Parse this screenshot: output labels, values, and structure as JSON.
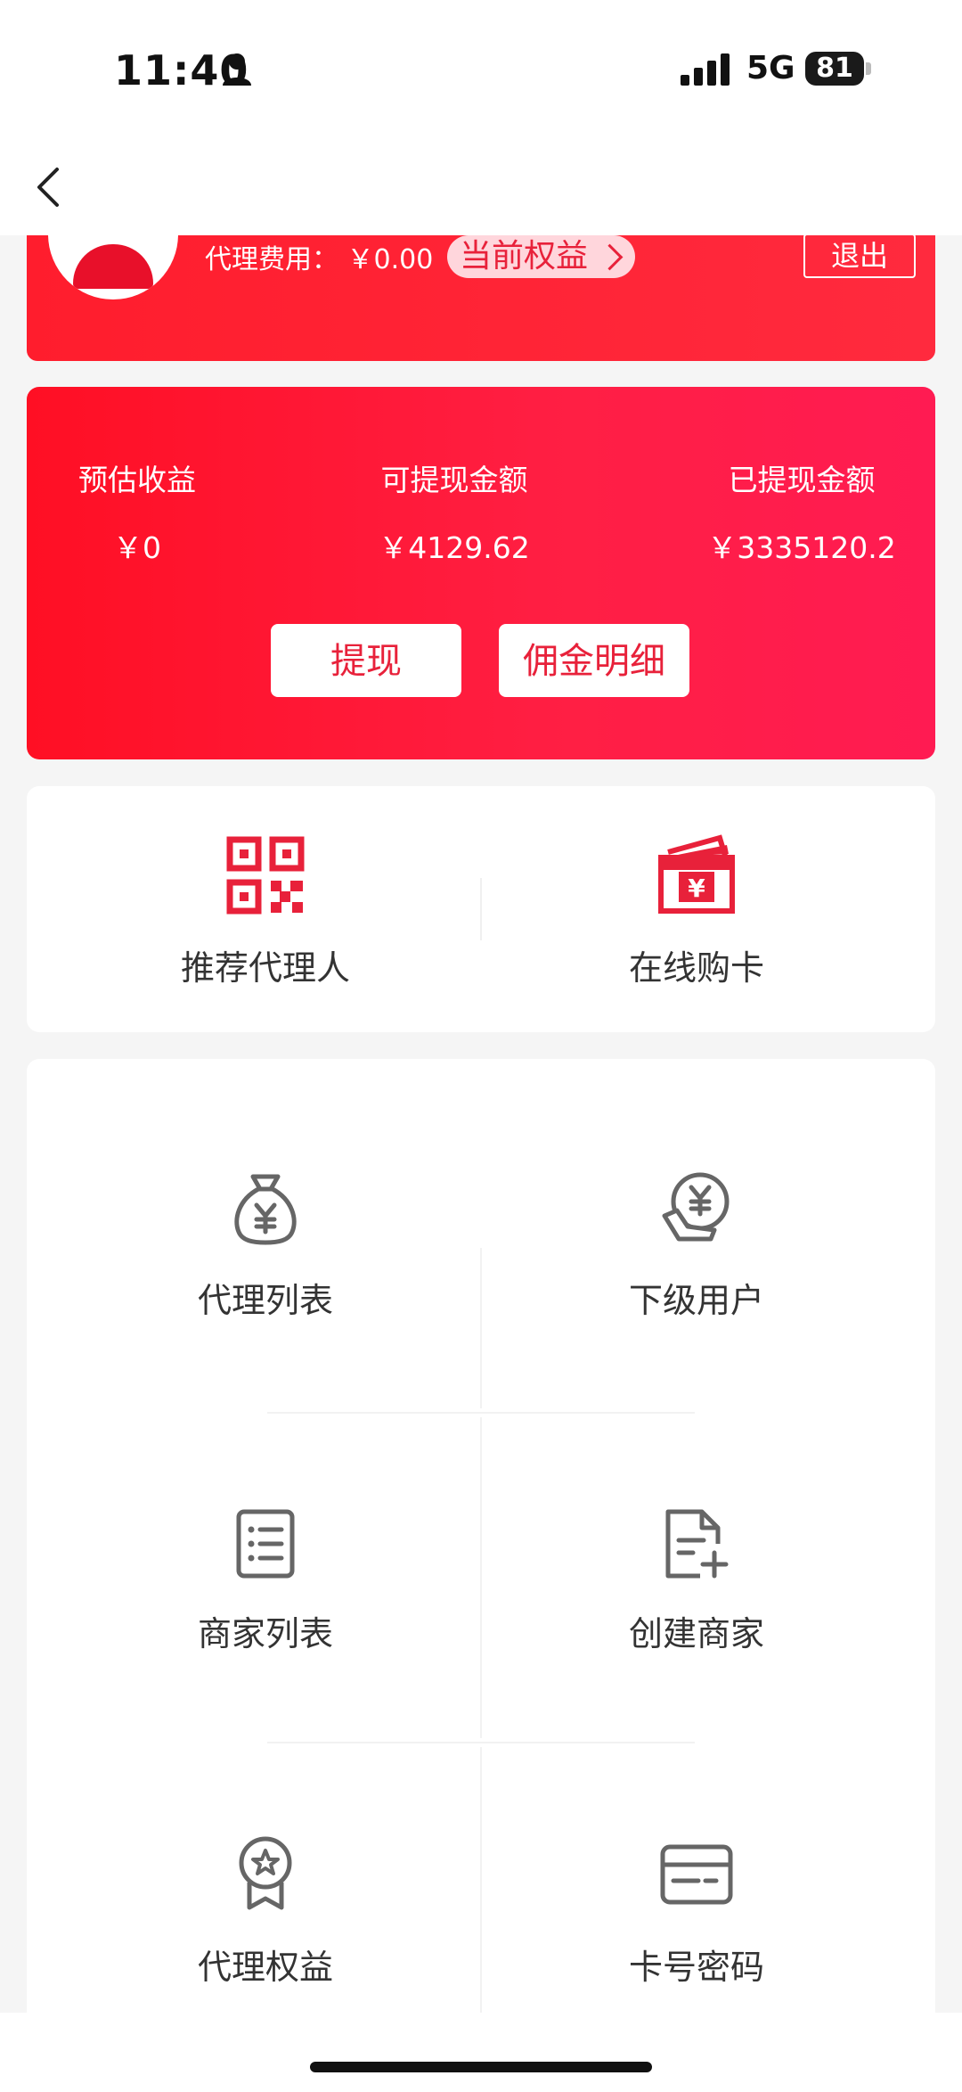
{
  "status_bar": {
    "time": "11:40",
    "network": "5G",
    "battery": "81"
  },
  "profile": {
    "fee_label": "代理费用：",
    "fee_value": "￥0.00",
    "rights_label": "当前权益",
    "logout_label": "退出"
  },
  "earnings": {
    "items": [
      {
        "label": "预估收益",
        "value": "￥0"
      },
      {
        "label": "可提现金额",
        "value": "￥4129.62"
      },
      {
        "label": "已提现金额",
        "value": "￥3335120.2"
      }
    ],
    "withdraw_label": "提现",
    "commission_label": "佣金明细"
  },
  "quick_actions": [
    {
      "label": "推荐代理人",
      "icon": "qr-code-icon"
    },
    {
      "label": "在线购卡",
      "icon": "yuan-card-icon"
    }
  ],
  "menu": [
    {
      "label": "代理列表",
      "icon": "money-bag-icon"
    },
    {
      "label": "下级用户",
      "icon": "yuan-hand-icon"
    },
    {
      "label": "商家列表",
      "icon": "list-doc-icon"
    },
    {
      "label": "创建商家",
      "icon": "doc-add-icon"
    },
    {
      "label": "代理权益",
      "icon": "badge-star-icon"
    },
    {
      "label": "卡号密码",
      "icon": "card-icon"
    }
  ],
  "colors": {
    "accent": "#e8213a",
    "gradient_start": "#ff0f24",
    "gradient_end": "#ff1b52"
  }
}
